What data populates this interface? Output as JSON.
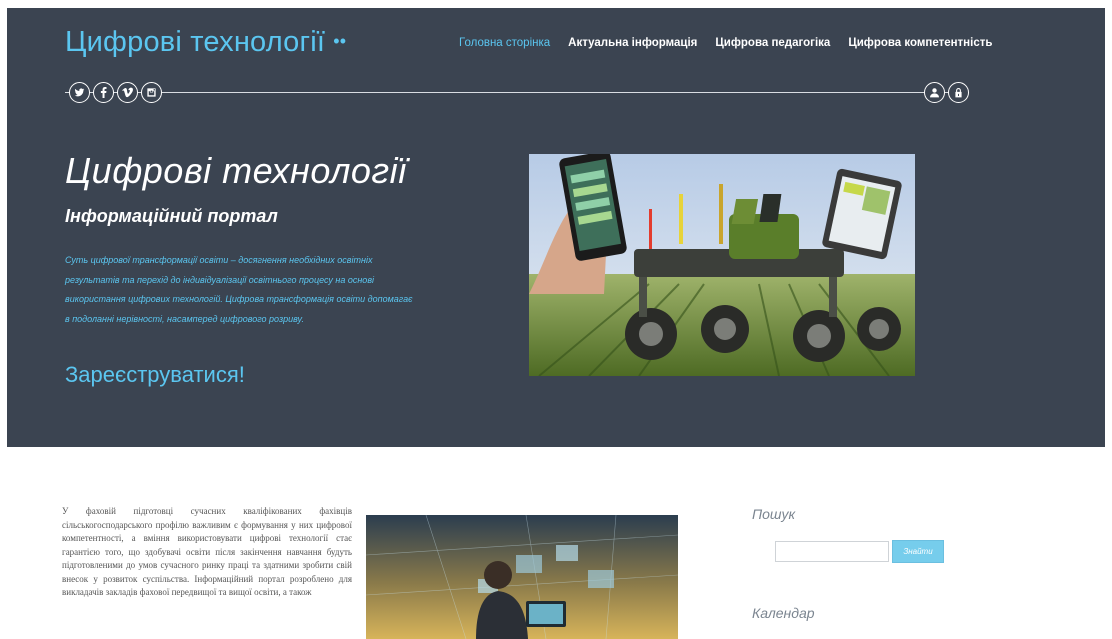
{
  "header": {
    "site_title": "Цифрові технології",
    "title_dots": "••",
    "nav": [
      {
        "label": "Головна сторінка",
        "active": true
      },
      {
        "label": "Актуальна інформація",
        "active": false
      },
      {
        "label": "Цифрова педагогіка",
        "active": false
      },
      {
        "label": "Цифрова компетентність",
        "active": false
      }
    ],
    "social_icons": [
      "twitter-icon",
      "facebook-icon",
      "vimeo-icon",
      "instagram-icon"
    ],
    "account_icons": [
      "user-icon",
      "lock-icon"
    ]
  },
  "hero": {
    "title": "Цифрові технології",
    "subtitle": "Інформаційний портал",
    "description": "Суть цифрової трансформації освіти – досягнення необхідних освітніх результатів та перехід до індивідуалізації освітнього процесу на основі використання цифрових технологій. Цифрова трансформація освіти допомагає в подоланні нерівності, насамперед цифрового розриву.",
    "register_link": "Зареєструватися!",
    "image_alt": "farm-robot-photo"
  },
  "content": {
    "intro_text": "У фаховій підготовці сучасних кваліфікованих фахівців сільськогосподарського профілю важливим є формування у них цифрової компетентності, а вміння використовувати цифрові технології стає гарантією того, що здобувачі освіти після закінчення навчання будуть підготовленими до умов сучасного ринку праці та здатними зробити свій внесок у розвиток суспільства. Інформаційний портал розроблено для викладачів закладів фахової передвищої та вищої освіти, а також",
    "image_alt": "digital-farmer-photo"
  },
  "sidebar": {
    "search_heading": "Пошук",
    "search_value": "",
    "search_button": "Знайти",
    "calendar_heading": "Календар"
  },
  "colors": {
    "hero_background": "#3b4451",
    "accent": "#5bc6f0",
    "button": "#76cdec"
  }
}
